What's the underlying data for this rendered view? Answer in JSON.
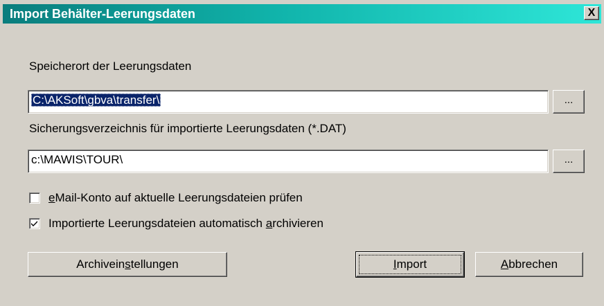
{
  "dialog": {
    "title": "Import Behälter-Leerungsdaten",
    "close_label": "X"
  },
  "storage": {
    "label": "Speicherort der Leerungsdaten",
    "value": "C:\\AKSoft\\gbva\\transfer\\",
    "browse_label": "..."
  },
  "backup": {
    "label": "Sicherungsverzeichnis für importierte Leerungsdaten (*.DAT)",
    "value": "c:\\MAWIS\\TOUR\\",
    "browse_label": "..."
  },
  "options": {
    "email_check": {
      "mnemonic": "e",
      "label_rest": "Mail-Konto auf aktuelle Leerungsdateien prüfen",
      "checked": false
    },
    "auto_archive": {
      "label_pre": "Importierte Leerungsdateien automatisch ",
      "mnemonic": "a",
      "label_rest": "rchivieren",
      "checked": true
    }
  },
  "buttons": {
    "archive_settings": {
      "pre": "Archivein",
      "mnemonic": "s",
      "rest": "tellungen"
    },
    "import": {
      "mnemonic": "I",
      "rest": "mport"
    },
    "cancel": {
      "mnemonic": "A",
      "rest": "bbrechen"
    }
  },
  "colors": {
    "title_gradient_start": "#0a7d7d",
    "title_gradient_end": "#2ee6d8",
    "face": "#d4d0c8",
    "selection": "#0a246a"
  }
}
